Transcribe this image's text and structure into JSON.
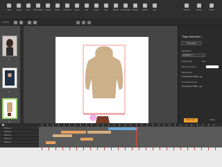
{
  "toolbar": {
    "tools": [
      {
        "label": "Page",
        "icon": "page-icon"
      },
      {
        "label": "Image",
        "icon": "image-icon"
      },
      {
        "label": "Audio",
        "icon": "audio-icon"
      },
      {
        "label": "Video Shape",
        "icon": "video-icon"
      },
      {
        "label": "Sharing",
        "icon": "share-icon"
      },
      {
        "label": "Button",
        "icon": "button-icon"
      },
      {
        "label": "Animation",
        "icon": "animation-icon"
      },
      {
        "label": "Action",
        "icon": "action-icon"
      },
      {
        "label": "Text",
        "icon": "text-icon"
      },
      {
        "label": "Shape",
        "icon": "shape-icon"
      },
      {
        "label": "Slide",
        "icon": "slide-icon"
      },
      {
        "label": "Markup",
        "icon": "markup-icon"
      },
      {
        "label": "Screenshots",
        "icon": "screenshot-icon"
      },
      {
        "label": "Website",
        "icon": "website-icon"
      },
      {
        "label": "Publish",
        "icon": "publish-icon"
      },
      {
        "label": "Tools",
        "icon": "tools-icon"
      }
    ],
    "right_tools": [
      {
        "label": "Preview",
        "icon": "preview-icon"
      },
      {
        "label": "Publish",
        "icon": "publish-icon"
      },
      {
        "label": "Export",
        "icon": "export-icon"
      }
    ]
  },
  "subbar": {
    "zoom": "▾ 87%"
  },
  "left_panel": {
    "slide_numbers": [
      "1",
      "2",
      "3"
    ]
  },
  "right_panel": {
    "title": "Page Definition...",
    "tab": "Properties",
    "fields": [
      {
        "label": "Page Name",
        "value": "undefined_1"
      },
      {
        "label": "Page Length",
        "value": "10 s"
      },
      {
        "label": "Background Color",
        "value": ""
      },
      {
        "label": "Page Picture",
        "value": "Thumbnail1773851...jpg"
      },
      {
        "label": "Thumbnail Picture",
        "value": "Thumbnail1773851...jpg"
      }
    ],
    "apply_label": "Structure",
    "close_label": "Close"
  },
  "timeline": {
    "rows": [
      "Frame_1",
      "Frame_2",
      "Frame_3",
      "Frame_4",
      "Frame_5"
    ]
  },
  "colors": {
    "accent": "#f0a030",
    "selection": "#e74c3c",
    "bar_orange": "#e8a060",
    "bar_blue": "#6fa8d8",
    "bar_tan": "#d8b080"
  }
}
